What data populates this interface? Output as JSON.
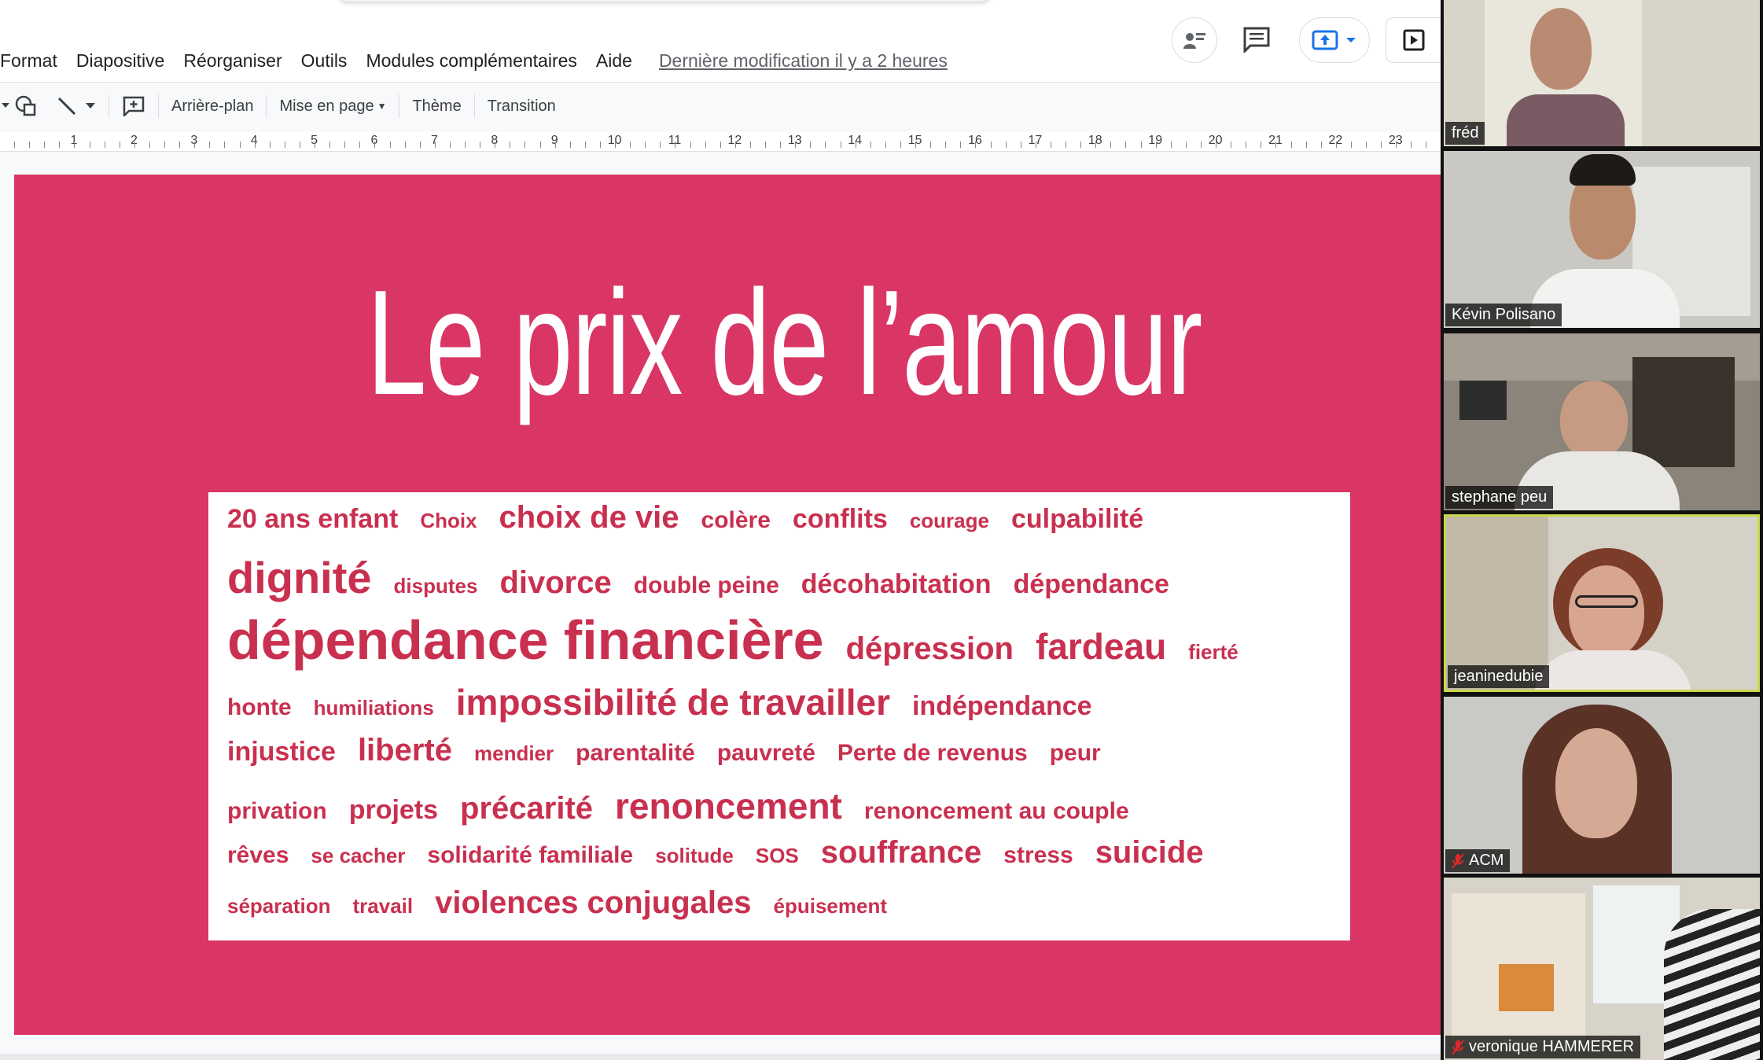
{
  "menubar": {
    "items": [
      "Format",
      "Diapositive",
      "Réorganiser",
      "Outils",
      "Modules complémentaires",
      "Aide"
    ],
    "last_edit": "Dernière modification il y a 2 heures"
  },
  "toolbar": {
    "background": "Arrière-plan",
    "layout": "Mise en page",
    "theme": "Thème",
    "transition": "Transition"
  },
  "ruler": {
    "numbers": [
      "1",
      "2",
      "3",
      "4",
      "5",
      "6",
      "7",
      "8",
      "9",
      "10",
      "11",
      "12",
      "13",
      "14",
      "15",
      "16",
      "17",
      "18",
      "19",
      "20",
      "21",
      "22",
      "23"
    ]
  },
  "slide": {
    "title": "Le prix de l’amour",
    "background_color": "#d93665",
    "word_color": "#c9304f",
    "word_cloud": [
      [
        [
          "20 ans enfant",
          "s3"
        ],
        [
          "Choix",
          "s1"
        ],
        [
          "choix de vie",
          "s4"
        ],
        [
          "colère",
          "s2"
        ],
        [
          "conflits",
          "s3"
        ],
        [
          "courage",
          "s1"
        ],
        [
          "culpabilité",
          "s3"
        ]
      ],
      [
        [
          "dignité",
          "s6"
        ],
        [
          "disputes",
          "s1"
        ],
        [
          "divorce",
          "s4"
        ],
        [
          "double peine",
          "s2"
        ],
        [
          "décohabitation",
          "s3"
        ],
        [
          "dépendance",
          "s3"
        ]
      ],
      [
        [
          "dépendance financière",
          "s7"
        ],
        [
          "dépression",
          "s4"
        ],
        [
          "fardeau",
          "s5"
        ],
        [
          "fierté",
          "s1"
        ]
      ],
      [
        [
          "honte",
          "s2"
        ],
        [
          "humiliations",
          "s1"
        ],
        [
          "impossibilité de travailler",
          "s5"
        ],
        [
          "indépendance",
          "s3"
        ]
      ],
      [
        [
          "injustice",
          "s3"
        ],
        [
          "liberté",
          "s4"
        ],
        [
          "mendier",
          "s1"
        ],
        [
          "parentalité",
          "s2"
        ],
        [
          "pauvreté",
          "s2"
        ],
        [
          "Perte de revenus",
          "s2"
        ],
        [
          "peur",
          "s2"
        ]
      ],
      [
        [
          "privation",
          "s2"
        ],
        [
          "projets",
          "s3"
        ],
        [
          "précarité",
          "s4"
        ],
        [
          "renoncement",
          "s5"
        ],
        [
          "renoncement au couple",
          "s2"
        ]
      ],
      [
        [
          "rêves",
          "s2"
        ],
        [
          "se cacher",
          "s1"
        ],
        [
          "solidarité familiale",
          "s2"
        ],
        [
          "solitude",
          "s1"
        ],
        [
          "SOS",
          "s1"
        ],
        [
          "souffrance",
          "s4"
        ],
        [
          "stress",
          "s2"
        ],
        [
          "suicide",
          "s4"
        ]
      ],
      [
        [
          "séparation",
          "s1"
        ],
        [
          "travail",
          "s1"
        ],
        [
          "violences conjugales",
          "s4"
        ],
        [
          "épuisement",
          "s1"
        ]
      ]
    ]
  },
  "participants": [
    {
      "name": "fréd",
      "muted": false,
      "active": false
    },
    {
      "name": "Kévin Polisano",
      "muted": false,
      "active": false
    },
    {
      "name": "stephane peu",
      "muted": false,
      "active": false
    },
    {
      "name": "jeaninedubie",
      "muted": false,
      "active": true
    },
    {
      "name": "ACM",
      "muted": true,
      "active": false
    },
    {
      "name": "veronique HAMMERER",
      "muted": true,
      "active": false
    }
  ],
  "colors": {
    "accent": "#1a73e8",
    "active_speaker_border": "#c8d84a",
    "mute_red": "#e02828"
  }
}
